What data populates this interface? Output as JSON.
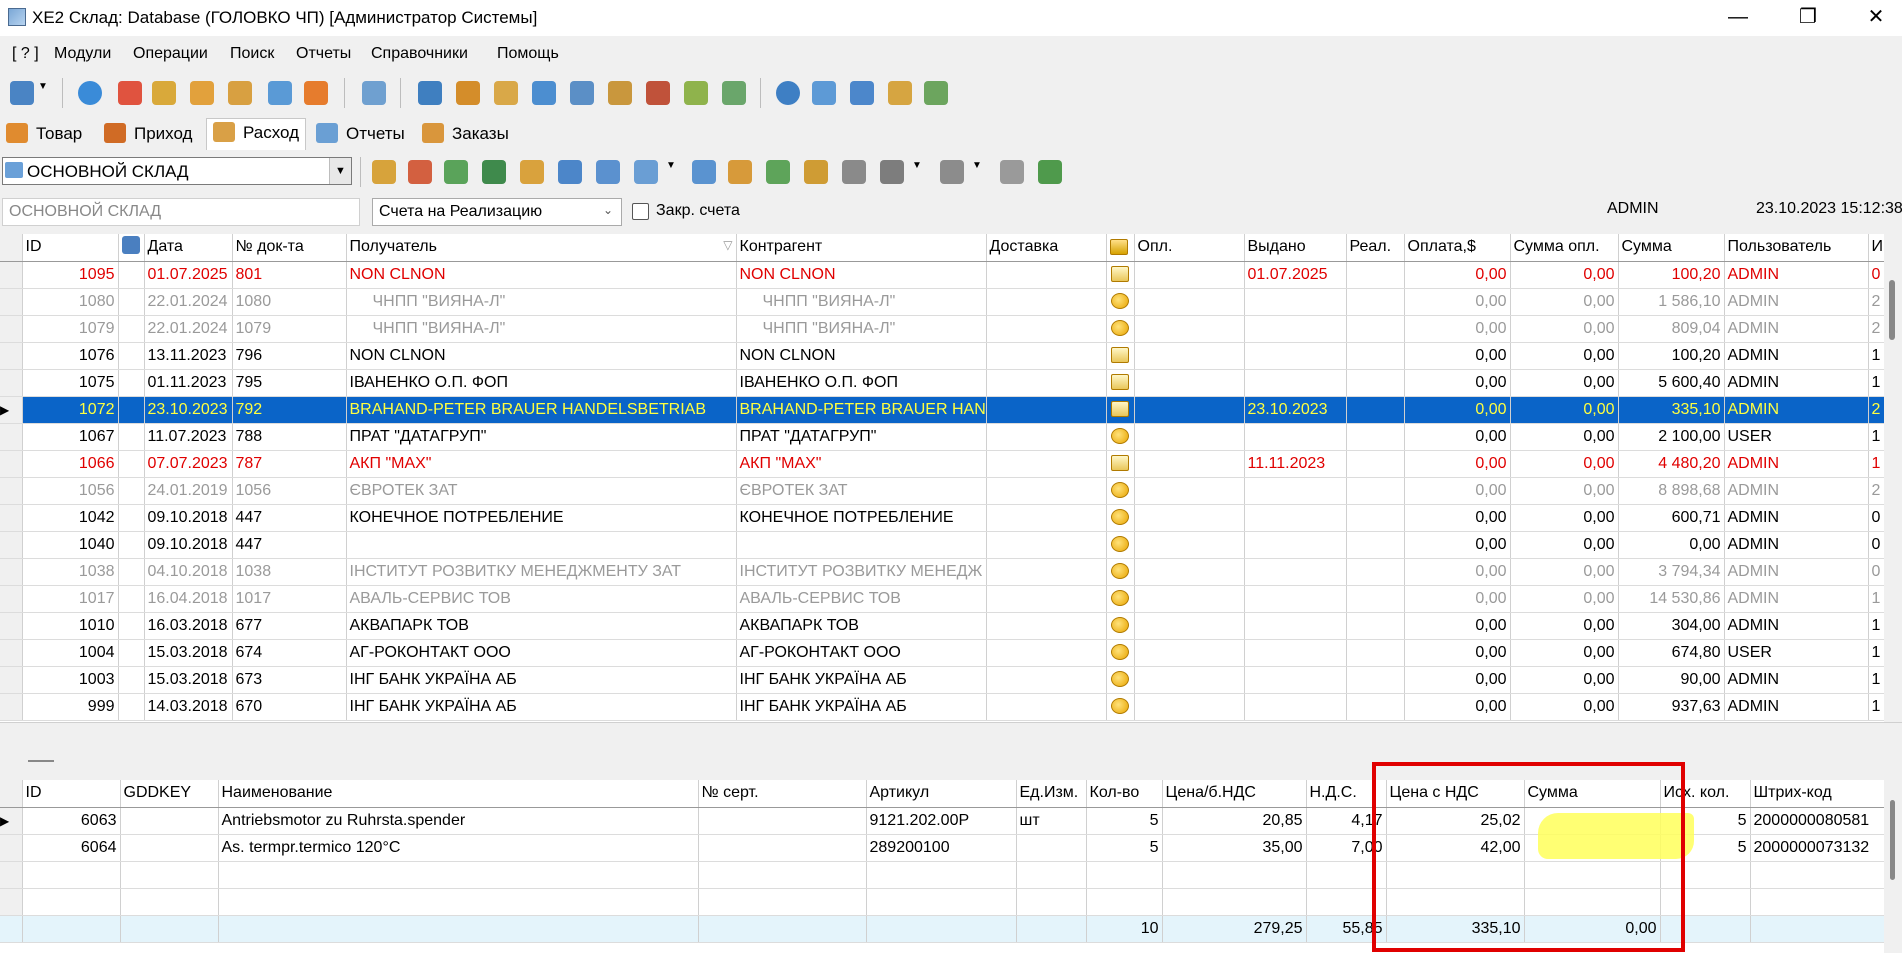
{
  "window": {
    "title": "XE2  Склад: Database (ГОЛОВКО ЧП) [Администратор Системы]",
    "minimize": "—",
    "restore": "❐",
    "close": "✕"
  },
  "menu": [
    "[ ? ]",
    "Модули",
    "Операции",
    "Поиск",
    "Отчеты",
    "Справочники",
    "Помощь"
  ],
  "tabs": [
    "Товар",
    "Приход",
    "Расход",
    "Отчеты",
    "Заказы"
  ],
  "active_tab": "Расход",
  "warehouse_combo": "ОСНОВНОЙ СКЛАД",
  "filter": {
    "warehouse_field": "ОСНОВНОЙ СКЛАД",
    "doc_type": "Счета на Реализацию",
    "closed_label": "Закр. счета",
    "user": "ADMIN",
    "datetime": "23.10.2023 15:12:38"
  },
  "grid1": {
    "headers": [
      "ID",
      "",
      "Дата",
      "№ док-та",
      "Получатель",
      "Контрагент",
      "Доставка",
      "",
      "Опл.",
      "Выдано",
      "Реал.",
      "Оплата,$",
      "Сумма опл.",
      "Сумма",
      "Пользователь",
      "И"
    ],
    "rows": [
      {
        "id": "1095",
        "date": "01.07.2025",
        "doc": "801",
        "recipient": "NON CLNON",
        "contractor": "NON CLNON",
        "issued": "01.07.2025",
        "pay": "0,00",
        "paysum": "0,00",
        "sum": "100,20",
        "user": "ADMIN",
        "extra": "0",
        "style": "red",
        "icon": "doc"
      },
      {
        "id": "1080",
        "date": "22.01.2024",
        "doc": "1080",
        "recipient": "ЧНПП \"ВИЯНА-Л\"",
        "contractor": "ЧНПП \"ВИЯНА-Л\"",
        "issued": "",
        "pay": "0,00",
        "paysum": "0,00",
        "sum": "1 586,10",
        "user": "ADMIN",
        "extra": "2",
        "style": "gray",
        "icon": "coin",
        "indent": true
      },
      {
        "id": "1079",
        "date": "22.01.2024",
        "doc": "1079",
        "recipient": "ЧНПП \"ВИЯНА-Л\"",
        "contractor": "ЧНПП \"ВИЯНА-Л\"",
        "issued": "",
        "pay": "0,00",
        "paysum": "0,00",
        "sum": "809,04",
        "user": "ADMIN",
        "extra": "2",
        "style": "gray",
        "icon": "coin",
        "indent": true
      },
      {
        "id": "1076",
        "date": "13.11.2023",
        "doc": "796",
        "recipient": "NON CLNON",
        "contractor": "NON CLNON",
        "issued": "",
        "pay": "0,00",
        "paysum": "0,00",
        "sum": "100,20",
        "user": "ADMIN",
        "extra": "1",
        "style": "",
        "icon": "doc"
      },
      {
        "id": "1075",
        "date": "01.11.2023",
        "doc": "795",
        "recipient": "ІВАНЕНКО О.П. ФОП",
        "contractor": "ІВАНЕНКО О.П. ФОП",
        "issued": "",
        "pay": "0,00",
        "paysum": "0,00",
        "sum": "5 600,40",
        "user": "ADMIN",
        "extra": "1",
        "style": "",
        "icon": "doc"
      },
      {
        "id": "1072",
        "date": "23.10.2023",
        "doc": "792",
        "recipient": "BRAHAND-PETER BRAUER HANDELSBETRIAB",
        "contractor": "BRAHAND-PETER BRAUER HAN",
        "issued": "23.10.2023",
        "pay": "0,00",
        "paysum": "0,00",
        "sum": "335,10",
        "user": "ADMIN",
        "extra": "2",
        "style": "sel",
        "icon": "doc"
      },
      {
        "id": "1067",
        "date": "11.07.2023",
        "doc": "788",
        "recipient": "ПРАТ \"ДАТАГРУП\"",
        "contractor": "ПРАТ \"ДАТАГРУП\"",
        "issued": "",
        "pay": "0,00",
        "paysum": "0,00",
        "sum": "2 100,00",
        "user": "USER",
        "extra": "1",
        "style": "",
        "icon": "coin"
      },
      {
        "id": "1066",
        "date": "07.07.2023",
        "doc": "787",
        "recipient": "АКП \"MAX\"",
        "contractor": "АКП \"MAX\"",
        "issued": "11.11.2023",
        "pay": "0,00",
        "paysum": "0,00",
        "sum": "4 480,20",
        "user": "ADMIN",
        "extra": "1",
        "style": "red",
        "icon": "doc"
      },
      {
        "id": "1056",
        "date": "24.01.2019",
        "doc": "1056",
        "recipient": "ЄВРОТЕК ЗАТ",
        "contractor": "ЄВРОТЕК ЗАТ",
        "issued": "",
        "pay": "0,00",
        "paysum": "0,00",
        "sum": "8 898,68",
        "user": "ADMIN",
        "extra": "2",
        "style": "gray",
        "icon": "coin"
      },
      {
        "id": "1042",
        "date": "09.10.2018",
        "doc": "447",
        "recipient": "КОНЕЧНОЕ ПОТРЕБЛЕНИЕ",
        "contractor": "КОНЕЧНОЕ ПОТРЕБЛЕНИЕ",
        "issued": "",
        "pay": "0,00",
        "paysum": "0,00",
        "sum": "600,71",
        "user": "ADMIN",
        "extra": "0",
        "style": "",
        "icon": "coin"
      },
      {
        "id": "1040",
        "date": "09.10.2018",
        "doc": "447",
        "recipient": "",
        "contractor": "",
        "issued": "",
        "pay": "0,00",
        "paysum": "0,00",
        "sum": "0,00",
        "user": "ADMIN",
        "extra": "0",
        "style": "",
        "icon": "coin"
      },
      {
        "id": "1038",
        "date": "04.10.2018",
        "doc": "1038",
        "recipient": "ІНСТИТУТ РОЗВИТКУ МЕНЕДЖМЕНТУ ЗАТ",
        "contractor": "ІНСТИТУТ РОЗВИТКУ МЕНЕДЖ",
        "issued": "",
        "pay": "0,00",
        "paysum": "0,00",
        "sum": "3 794,34",
        "user": "ADMIN",
        "extra": "0",
        "style": "gray",
        "icon": "coin"
      },
      {
        "id": "1017",
        "date": "16.04.2018",
        "doc": "1017",
        "recipient": "АВАЛЬ-СЕРВИС ТОВ",
        "contractor": "АВАЛЬ-СЕРВИС ТОВ",
        "issued": "",
        "pay": "0,00",
        "paysum": "0,00",
        "sum": "14 530,86",
        "user": "ADMIN",
        "extra": "1",
        "style": "gray",
        "icon": "coin"
      },
      {
        "id": "1010",
        "date": "16.03.2018",
        "doc": "677",
        "recipient": "АКВАПАРК ТОВ",
        "contractor": "АКВАПАРК ТОВ",
        "issued": "",
        "pay": "0,00",
        "paysum": "0,00",
        "sum": "304,00",
        "user": "ADMIN",
        "extra": "1",
        "style": "",
        "icon": "coin"
      },
      {
        "id": "1004",
        "date": "15.03.2018",
        "doc": "674",
        "recipient": "АГ-РОКОНТАКТ ООО",
        "contractor": "АГ-РОКОНТАКТ ООО",
        "issued": "",
        "pay": "0,00",
        "paysum": "0,00",
        "sum": "674,80",
        "user": "USER",
        "extra": "1",
        "style": "",
        "icon": "coin"
      },
      {
        "id": "1003",
        "date": "15.03.2018",
        "doc": "673",
        "recipient": "ІНГ БАНК УКРАЇНА АБ",
        "contractor": "ІНГ БАНК УКРАЇНА АБ",
        "issued": "",
        "pay": "0,00",
        "paysum": "0,00",
        "sum": "90,00",
        "user": "ADMIN",
        "extra": "1",
        "style": "",
        "icon": "coin"
      },
      {
        "id": "999",
        "date": "14.03.2018",
        "doc": "670",
        "recipient": "ІНГ БАНК УКРАЇНА АБ",
        "contractor": "ІНГ БАНК УКРАЇНА АБ",
        "issued": "",
        "pay": "0,00",
        "paysum": "0,00",
        "sum": "937,63",
        "user": "ADMIN",
        "extra": "1",
        "style": "",
        "icon": "coin"
      }
    ]
  },
  "grid2": {
    "headers": [
      "ID",
      "GDDKEY",
      "Наименование",
      "№ серт.",
      "Артикул",
      "Ед.Изм.",
      "Кол-во",
      "Цена/б.НДС",
      "Н.Д.С.",
      "Цена с НДС",
      "Сумма",
      "Исх. кол.",
      "Штрих-код"
    ],
    "rows": [
      {
        "id": "6063",
        "gddkey": "",
        "name": "Antriebsmotor zu Ruhrsta.spender",
        "cert": "",
        "art": "9121.202.00P",
        "unit": "шт",
        "qty": "5",
        "price": "20,85",
        "vat": "4,17",
        "price_vat": "25,02",
        "sum": "",
        "orig_qty": "5",
        "barcode": "2000000080581"
      },
      {
        "id": "6064",
        "gddkey": "",
        "name": "As. termpr.termico 120°C",
        "cert": "",
        "art": "289200100",
        "unit": "",
        "qty": "5",
        "price": "35,00",
        "vat": "7,00",
        "price_vat": "42,00",
        "sum": "",
        "orig_qty": "5",
        "barcode": "2000000073132"
      }
    ],
    "totals": {
      "qty": "10",
      "price": "279,25",
      "vat": "55,85",
      "price_vat": "335,10",
      "sum": "0,00"
    }
  }
}
